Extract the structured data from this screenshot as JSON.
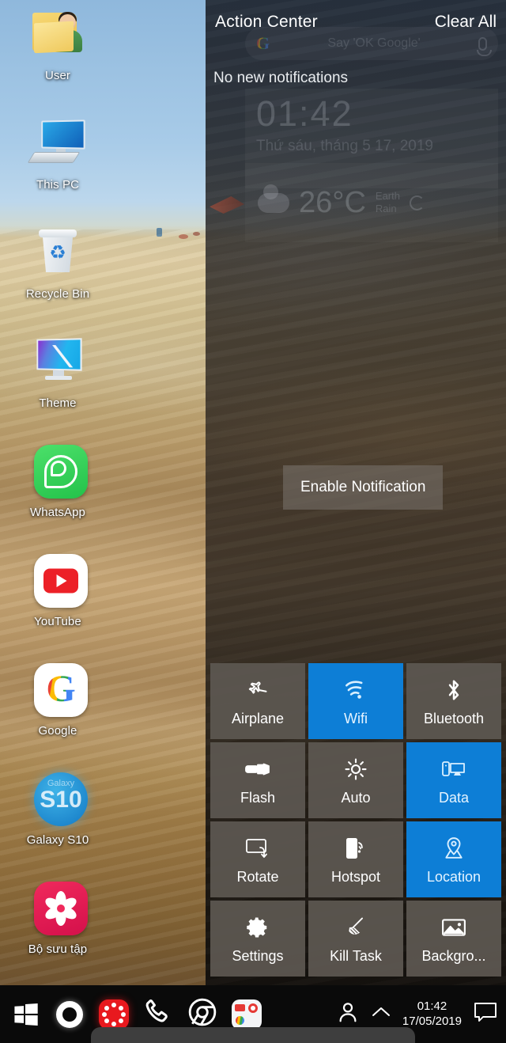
{
  "desktop": {
    "icons": [
      {
        "label": "User",
        "icon": "user-folder-icon"
      },
      {
        "label": "This PC",
        "icon": "computer-icon"
      },
      {
        "label": "Recycle Bin",
        "icon": "recycle-bin-icon"
      },
      {
        "label": "Theme",
        "icon": "theme-monitor-icon"
      },
      {
        "label": "WhatsApp",
        "icon": "whatsapp-icon"
      },
      {
        "label": "YouTube",
        "icon": "youtube-icon"
      },
      {
        "label": "Google",
        "icon": "google-icon"
      },
      {
        "label": "Galaxy S10",
        "icon": "galaxy-s10-icon"
      },
      {
        "label": "Bộ sưu tập",
        "icon": "gallery-flower-icon"
      }
    ]
  },
  "action_center": {
    "title": "Action Center",
    "clear_all": "Clear All",
    "empty_text": "No new notifications",
    "toast": "Enable Notification",
    "ghost_widgets": {
      "search_placeholder": "Say 'OK Google'",
      "clock_time": "01:42",
      "clock_date": "Thứ sáu, tháng 5 17, 2019",
      "weather_temp": "26°C",
      "weather_line1": "Earth",
      "weather_line2": "Rain"
    }
  },
  "quick_settings": {
    "active_color": "#0d7ed6",
    "inactive_color": "#5c5650",
    "tiles": [
      {
        "label": "Airplane",
        "icon": "airplane-icon",
        "active": false
      },
      {
        "label": "Wifi",
        "icon": "wifi-icon",
        "active": true
      },
      {
        "label": "Bluetooth",
        "icon": "bluetooth-icon",
        "active": false
      },
      {
        "label": "Flash",
        "icon": "flashlight-icon",
        "active": false
      },
      {
        "label": "Auto",
        "icon": "brightness-icon",
        "active": false
      },
      {
        "label": "Data",
        "icon": "mobile-data-icon",
        "active": true
      },
      {
        "label": "Rotate",
        "icon": "rotate-icon",
        "active": false
      },
      {
        "label": "Hotspot",
        "icon": "hotspot-icon",
        "active": false
      },
      {
        "label": "Location",
        "icon": "location-pin-icon",
        "active": true
      },
      {
        "label": "Settings",
        "icon": "gear-icon",
        "active": false
      },
      {
        "label": "Kill Task",
        "icon": "broom-icon",
        "active": false
      },
      {
        "label": "Backgro...",
        "icon": "image-icon",
        "active": false
      }
    ]
  },
  "taskbar": {
    "items": [
      {
        "name": "start-button",
        "icon": "windows-logo-icon"
      },
      {
        "name": "cortana-button",
        "icon": "ring-icon"
      },
      {
        "name": "app-red-button",
        "icon": "red-dots-icon"
      },
      {
        "name": "phone-button",
        "icon": "phone-icon"
      },
      {
        "name": "chrome-button",
        "icon": "chrome-icon"
      },
      {
        "name": "media-app-button",
        "icon": "app-tile-icon"
      }
    ],
    "tray": {
      "user_icon": "person-icon",
      "chevron_icon": "chevron-up-icon",
      "time": "01:42",
      "date": "17/05/2019",
      "notification_icon": "speech-bubble-icon"
    }
  }
}
